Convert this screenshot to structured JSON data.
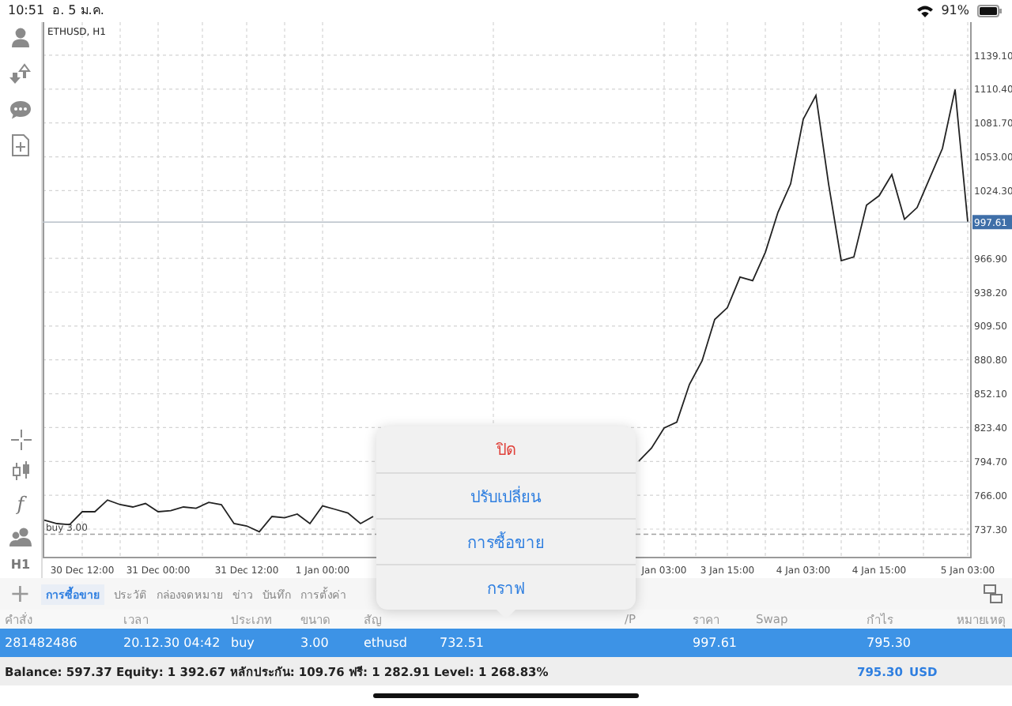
{
  "status_bar": {
    "time": "10:51",
    "date": "อ. 5 ม.ค.",
    "battery": "91%"
  },
  "toolbar": {
    "function_glyph": "f",
    "period": "H1",
    "add_glyph": "+"
  },
  "chart": {
    "title": "ETHUSD, H1",
    "chart_data": {
      "type": "line",
      "grid": true,
      "categories": [
        null,
        null,
        null,
        "30 Dec 12:00",
        null,
        null,
        null,
        null,
        null,
        "31 Dec 00:00",
        null,
        null,
        null,
        null,
        null,
        null,
        "31 Dec 12:00",
        null,
        null,
        null,
        null,
        null,
        "1 Jan 00:00",
        null,
        null,
        null,
        null,
        null,
        null,
        null,
        null,
        null,
        null,
        null,
        null,
        null,
        null,
        null,
        null,
        null,
        null,
        null,
        null,
        null,
        null,
        null,
        null,
        null,
        null,
        "Jan 03:00",
        null,
        null,
        null,
        null,
        "3 Jan 15:00",
        null,
        null,
        null,
        null,
        null,
        "4 Jan 03:00",
        null,
        null,
        null,
        null,
        null,
        "4 Jan 15:00",
        null,
        null,
        null,
        null,
        null,
        null,
        "5 Jan 03:00"
      ],
      "ylim": [
        713.2,
        1167.2
      ],
      "yticks": [
        {
          "value": 737.3,
          "label": "737.30"
        },
        {
          "value": 766,
          "label": "766.00"
        },
        {
          "value": 794.7,
          "label": "794.70"
        },
        {
          "value": 823.4,
          "label": "823.40"
        },
        {
          "value": 852.1,
          "label": "852.10"
        },
        {
          "value": 880.8,
          "label": "880.80"
        },
        {
          "value": 909.5,
          "label": "909.50"
        },
        {
          "value": 938.2,
          "label": "938.20"
        },
        {
          "value": 966.9,
          "label": "966.90"
        },
        {
          "value": 1024.3,
          "label": "1024.30"
        },
        {
          "value": 1053,
          "label": "1053.00"
        },
        {
          "value": 1081.7,
          "label": "1081.70"
        },
        {
          "value": 1110.4,
          "label": "1110.40"
        },
        {
          "value": 1139.1,
          "label": "1139.10"
        }
      ],
      "series": [
        {
          "color": "#222222",
          "values": [
            745,
            742,
            741,
            752,
            752,
            762,
            758,
            756,
            759,
            752,
            753,
            756,
            755,
            760,
            758,
            742,
            740,
            735,
            748,
            747,
            750,
            742,
            757,
            754,
            751,
            742,
            748,
            null,
            null,
            null,
            null,
            null,
            null,
            null,
            null,
            null,
            null,
            null,
            null,
            null,
            null,
            null,
            null,
            null,
            null,
            null,
            null,
            795,
            806,
            823,
            828,
            860,
            880,
            915,
            925,
            951,
            948,
            972,
            1006,
            1030,
            1085,
            1105,
            1030,
            965,
            968,
            1012,
            1020,
            1038,
            1000,
            1010,
            1035,
            1060,
            1110,
            998
          ]
        }
      ],
      "ref_lines": [
        {
          "axis": "y",
          "value": 997.61,
          "label": "997.61"
        },
        {
          "axis": "y",
          "value": 733,
          "label": "buy 3.00"
        }
      ]
    }
  },
  "popover": {
    "items": [
      {
        "label": "ปิด",
        "kind": "destructive"
      },
      {
        "label": "ปรับเปลี่ยน",
        "kind": "default"
      },
      {
        "label": "การซื้อขาย",
        "kind": "default"
      },
      {
        "label": "กราฟ",
        "kind": "default"
      }
    ]
  },
  "tabs": [
    {
      "label": "การซื้อขาย",
      "selected": true
    },
    {
      "label": "ประวัติ",
      "selected": false
    },
    {
      "label": "กล่องจดหมาย",
      "selected": false
    },
    {
      "label": "ข่าว",
      "selected": false
    },
    {
      "label": "บันทึก",
      "selected": false
    },
    {
      "label": "การตั้งค่า",
      "selected": false
    }
  ],
  "table": {
    "columns": [
      "คำสั่ง",
      "เวลา",
      "ประเภท",
      "ขนาด",
      "สัญ",
      null,
      null,
      "/P",
      "ราคา",
      "Swap",
      "กำไร",
      "หมายเหตุ"
    ],
    "rows": [
      {
        "selected": true,
        "cells": [
          "281482486",
          "20.12.30 04:42",
          "buy",
          "3.00",
          "ethusd",
          "732.51",
          null,
          null,
          "997.61",
          null,
          "795.30",
          null
        ]
      }
    ]
  },
  "summary": {
    "text": "Balance: 597.37 Equity: 1 392.67 หลักประกัน: 109.76 ฟรี: 1 282.91 Level: 1 268.83%",
    "profit": "795.30",
    "currency": "USD"
  }
}
